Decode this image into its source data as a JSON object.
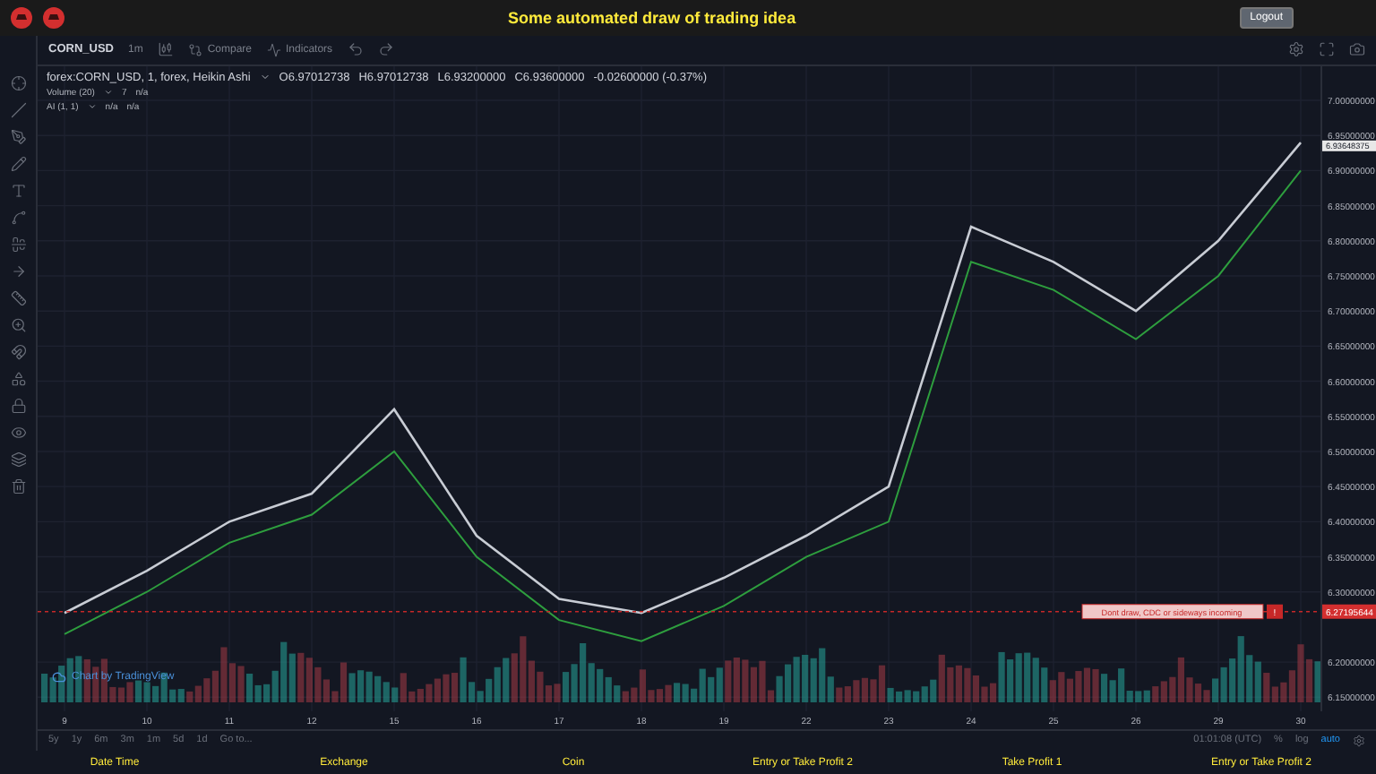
{
  "header": {
    "title": "Some automated draw of trading idea",
    "logout": "Logout"
  },
  "toolbar": {
    "symbol": "CORN_USD",
    "interval": "1m",
    "buttons": [
      "Compare",
      "Indicators"
    ]
  },
  "legend": {
    "title": "forex:CORN_USD, 1, forex, Heikin Ashi",
    "ohlc": [
      "O6.97012738",
      "H6.97012738",
      "L6.93200000",
      "C6.93600000"
    ],
    "change": "-0.02600000 (-0.37%)"
  },
  "studies": [
    {
      "name": "Volume (20)",
      "values": [
        "7",
        "n/a"
      ]
    },
    {
      "name": "AI (1, 1)",
      "values": [
        "n/a",
        "n/a"
      ]
    }
  ],
  "chart": {
    "chart_data": {
      "type": "line",
      "grid": true,
      "categories": [
        "9",
        "10",
        "11",
        "12",
        "15",
        "16",
        "17",
        "18",
        "19",
        "22",
        "23",
        "24",
        "25",
        "26",
        "29",
        "30"
      ],
      "series": [
        {
          "color": "#c8ccd4",
          "values": [
            6.27,
            6.33,
            6.4,
            6.44,
            6.56,
            6.38,
            6.29,
            6.27,
            6.32,
            6.38,
            6.45,
            6.82,
            6.77,
            6.7,
            6.8,
            6.94
          ]
        },
        {
          "color": "#2e9e3e",
          "values": [
            6.24,
            6.3,
            6.37,
            6.41,
            6.5,
            6.35,
            6.26,
            6.23,
            6.28,
            6.35,
            6.4,
            6.77,
            6.73,
            6.66,
            6.75,
            6.9
          ]
        }
      ],
      "ylim": [
        6.13,
        7.0485
      ],
      "ref_lines": [
        {
          "axis": "y",
          "value": 6.27195644,
          "color": "#c62828"
        }
      ],
      "yticks": [
        {
          "value": 7.0,
          "label": "7.00000000"
        },
        {
          "value": 6.95,
          "label": "6.95000000"
        },
        {
          "value": 6.9,
          "label": "6.90000000"
        },
        {
          "value": 6.85,
          "label": "6.85000000"
        },
        {
          "value": 6.8,
          "label": "6.80000000"
        },
        {
          "value": 6.75,
          "label": "6.75000000"
        },
        {
          "value": 6.7,
          "label": "6.70000000"
        },
        {
          "value": 6.65,
          "label": "6.65000000"
        },
        {
          "value": 6.6,
          "label": "6.60000000"
        },
        {
          "value": 6.55,
          "label": "6.55000000"
        },
        {
          "value": 6.5,
          "label": "6.50000000"
        },
        {
          "value": 6.45,
          "label": "6.45000000"
        },
        {
          "value": 6.4,
          "label": "6.40000000"
        },
        {
          "value": 6.35,
          "label": "6.35000000"
        },
        {
          "value": 6.3,
          "label": "6.30000000"
        },
        {
          "value": 6.2,
          "label": "6.20000000"
        },
        {
          "value": 6.15,
          "label": "6.15000000"
        }
      ]
    },
    "current_price": "6.93648375",
    "alert": {
      "text": "Dont draw, CDC or sideways incoming",
      "badge": "!",
      "price": "6.27195644"
    },
    "attribution": "Chart by TradingView"
  },
  "range_buttons": [
    "5y",
    "1y",
    "6m",
    "3m",
    "1m",
    "5d",
    "1d",
    "Go to..."
  ],
  "clock": "01:01:08 (UTC)",
  "scale_buttons": [
    {
      "label": "%",
      "selected": false
    },
    {
      "label": "log",
      "selected": false
    },
    {
      "label": "auto",
      "selected": true
    }
  ],
  "footer": [
    "Date Time",
    "Exchange",
    "Coin",
    "Entry or Take Profit 2",
    "Take Profit 1",
    "Entry or Take Profit 2"
  ]
}
